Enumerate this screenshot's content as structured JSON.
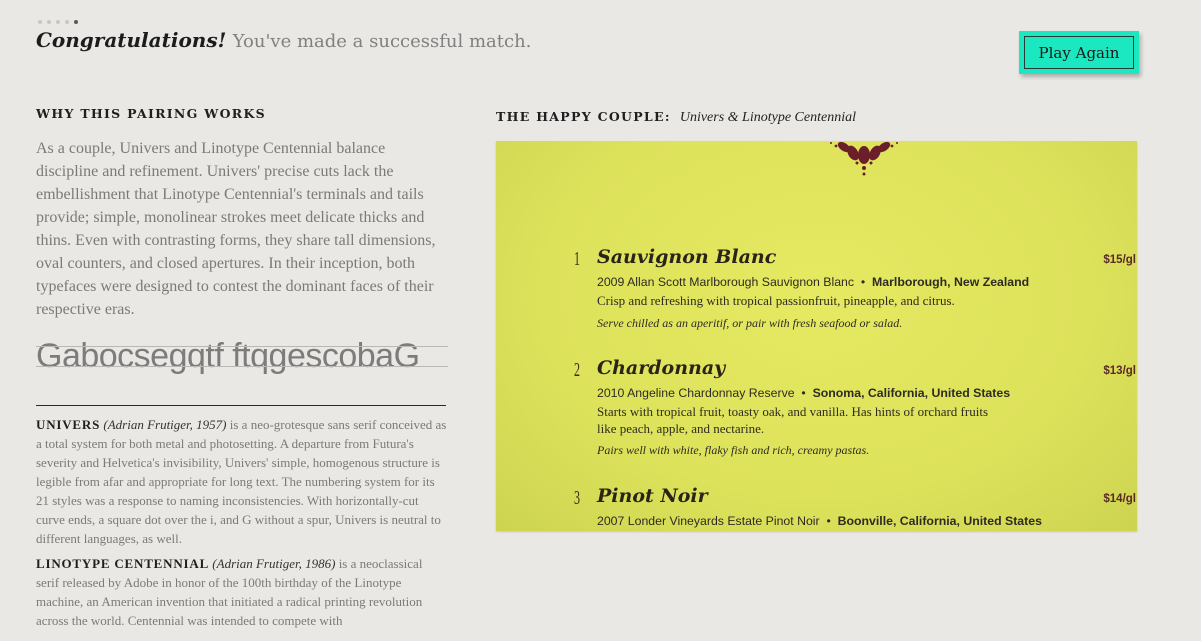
{
  "progress": {
    "current": 5,
    "total": 5
  },
  "header": {
    "congrats": "Congratulations!",
    "message": "You've made a successful match.",
    "play_again": "Play Again"
  },
  "pairing": {
    "heading": "WHY THIS PAIRING WORKS",
    "body": "As a couple, Univers and Linotype Centennial balance discipline and refinement. Univers' precise cuts lack the embellishment that Linotype Centennial's terminals and tails provide; simple, monolinear strokes meet delicate thicks and thins. Even with contrasting forms, they share tall dimensions, oval counters, and closed apertures. In their inception, both typefaces were designed to contest the dominant faces of their respective eras.",
    "specimen": "Gabocsegqtf ftqgescobaG"
  },
  "bios": [
    {
      "name": "UNIVERS",
      "meta": "(Adrian Frutiger, 1957)",
      "text": " is a neo-grotesque sans serif conceived as a total system for both metal and photosetting. A departure from Futura's severity and Helvetica's invisibility, Univers' simple, homogenous structure is legible from afar and appropriate for long text. The numbering system for its 21 styles was a response to naming inconsistencies. With horizontally-cut curve ends, a square dot over the i, and G without a spur, Univers is neutral to different languages, as well."
    },
    {
      "name": "LINOTYPE CENTENNIAL",
      "meta": "(Adrian Frutiger, 1986)",
      "text": " is a neoclassical serif released by Adobe in honor of the 100th birthday of the Linotype machine, an American invention that initiated a radical printing revolution across the world. Centennial was intended to compete with"
    }
  ],
  "couple": {
    "heading": "THE HAPPY COUPLE:",
    "names": "Univers & Linotype Centennial"
  },
  "menu": {
    "wines": [
      {
        "num": "1",
        "title": "Sauvignon Blanc",
        "price": "$15/gl",
        "vintage": "2009 Allan Scott Marlborough Sauvignon Blanc",
        "region": "Marlborough, New Zealand",
        "desc": "Crisp and refreshing with tropical passionfruit, pineapple, and citrus.",
        "serve": "Serve chilled as an aperitif, or pair with fresh seafood or salad."
      },
      {
        "num": "2",
        "title": "Chardonnay",
        "price": "$13/gl",
        "vintage": "2010 Angeline Chardonnay Reserve",
        "region": "Sonoma, California, United States",
        "desc": "Starts with tropical fruit, toasty oak, and vanilla. Has hints of orchard fruits like peach, apple, and nectarine.",
        "serve": "Pairs well with white, flaky fish and rich, creamy pastas."
      },
      {
        "num": "3",
        "title": "Pinot Noir",
        "price": "$14/gl",
        "vintage": "2007 Londer Vineyards Estate Pinot Noir",
        "region": "Boonville, California, United States"
      }
    ]
  },
  "colors": {
    "accent": "#1be8c0",
    "card": "#dde25b",
    "ornament": "#6b1f2a"
  }
}
